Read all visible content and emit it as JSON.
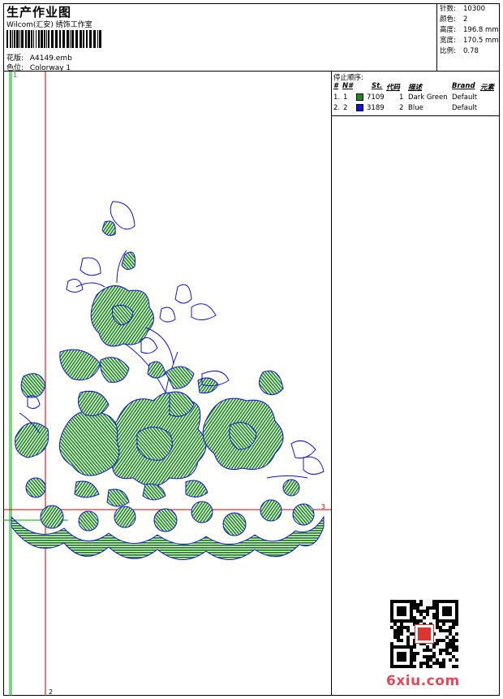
{
  "header": {
    "title": "生产作业图",
    "subtitle": "Wilcom(汇安) 绣饰工作室",
    "design_label": "花版:",
    "design_file": "A4149.emb",
    "colorway_label": "色位:",
    "colorway": "Colorway 1"
  },
  "stats": [
    {
      "label": "针数:",
      "value": "10300"
    },
    {
      "label": "颜色:",
      "value": "2"
    },
    {
      "label": "高度:",
      "value": "196.8 mm"
    },
    {
      "label": "宽度:",
      "value": "170.5 mm"
    },
    {
      "label": "比例:",
      "value": "0.78"
    }
  ],
  "stop_sequence": {
    "title": "停止顺序:",
    "headers": {
      "num": "#",
      "n": "N#",
      "st": "St.",
      "code": "代码",
      "desc": "描述",
      "brand": "Brand",
      "elem": "元素"
    },
    "rows": [
      {
        "num": "1.",
        "n": "1",
        "color": "#1a8a1a",
        "code": "7109",
        "st": "1",
        "desc": "Dark Green",
        "brand": "Default"
      },
      {
        "num": "2.",
        "n": "2",
        "color": "#1111dd",
        "code": "3189",
        "st": "2",
        "desc": "Blue",
        "brand": "Default"
      }
    ]
  },
  "guides": {
    "v1_label": "1",
    "v2_label": "2",
    "h_label": "3"
  },
  "watermark": {
    "text": "6xiu.com",
    "seal": "汇安绣饰"
  },
  "colors": {
    "green": "#1a8a1a",
    "blue": "#1111dd",
    "guide_red": "#cc0000",
    "guide_green": "#00aa00"
  }
}
